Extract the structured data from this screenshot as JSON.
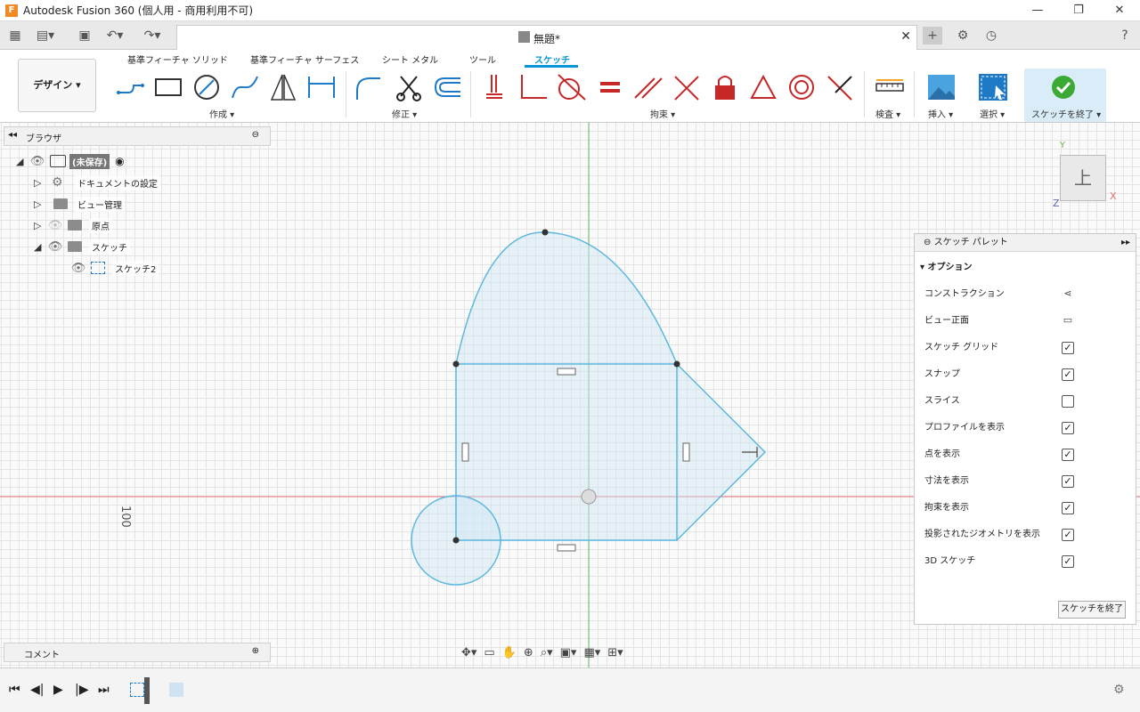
{
  "window": {
    "title": "Autodesk Fusion 360 (個人用 - 商用利用不可)",
    "app_icon": "F",
    "minimize": "—",
    "maximize": "❐",
    "close": "✕"
  },
  "document": {
    "title": "無題*",
    "close": "✕"
  },
  "workspace": {
    "label": "デザイン"
  },
  "ribbon": {
    "tabs": [
      {
        "label": "基準フィーチャ ソリッド"
      },
      {
        "label": "基準フィーチャ サーフェス"
      },
      {
        "label": "シート メタル"
      },
      {
        "label": "ツール"
      },
      {
        "label": "スケッチ"
      }
    ],
    "active_tab": "スケッチ",
    "groups": [
      {
        "label": "作成 ▾"
      },
      {
        "label": "修正 ▾"
      },
      {
        "label": "拘束 ▾"
      },
      {
        "label": "検査 ▾"
      },
      {
        "label": "挿入 ▾"
      },
      {
        "label": "選択 ▾"
      },
      {
        "label": "スケッチを終了 ▾"
      }
    ]
  },
  "browser": {
    "title": "ブラウザ",
    "items": [
      {
        "label": "(未保存)"
      },
      {
        "label": "ドキュメントの設定"
      },
      {
        "label": "ビュー管理"
      },
      {
        "label": "原点"
      },
      {
        "label": "スケッチ"
      },
      {
        "label": "スケッチ2"
      }
    ]
  },
  "canvas": {
    "dimension_label": "100",
    "viewcube_face": "上",
    "axis_x": "X",
    "axis_y": "Y",
    "axis_z": "Z"
  },
  "sketch_palette": {
    "title": "スケッチ パレット",
    "section": "オプション",
    "options": [
      {
        "label": "コンストラクション",
        "control": "icon",
        "checked": false
      },
      {
        "label": "ビュー正面",
        "control": "icon",
        "checked": false
      },
      {
        "label": "スケッチ グリッド",
        "control": "checkbox",
        "checked": true
      },
      {
        "label": "スナップ",
        "control": "checkbox",
        "checked": true
      },
      {
        "label": "スライス",
        "control": "checkbox",
        "checked": false
      },
      {
        "label": "プロファイルを表示",
        "control": "checkbox",
        "checked": true
      },
      {
        "label": "点を表示",
        "control": "checkbox",
        "checked": true
      },
      {
        "label": "寸法を表示",
        "control": "checkbox",
        "checked": true
      },
      {
        "label": "拘束を表示",
        "control": "checkbox",
        "checked": true
      },
      {
        "label": "投影されたジオメトリを表示",
        "control": "checkbox",
        "checked": true
      },
      {
        "label": "3D スケッチ",
        "control": "checkbox",
        "checked": true
      }
    ],
    "finish_button": "スケッチを終了"
  },
  "comments": {
    "label": "コメント"
  },
  "colors": {
    "accent": "#0696d7",
    "sketch_line": "#5cb8e0",
    "x_axis": "#e57373",
    "y_axis": "#66bb6a"
  }
}
